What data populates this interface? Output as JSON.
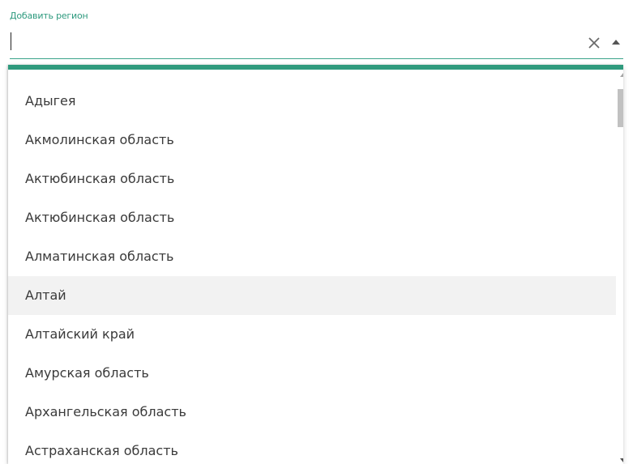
{
  "field": {
    "label": "Добавить регион",
    "value": "",
    "placeholder": ""
  },
  "icons": {
    "clear": "close-icon",
    "toggle": "caret-up-icon"
  },
  "colors": {
    "accent": "#2f9a7d",
    "label": "#2e9a7e",
    "active_row": "#f2f2f2"
  },
  "dropdown": {
    "items": [
      {
        "label": "Адыгея"
      },
      {
        "label": "Акмолинская область"
      },
      {
        "label": "Актюбинская область"
      },
      {
        "label": "Актюбинская область"
      },
      {
        "label": "Алматинская область"
      },
      {
        "label": "Алтай"
      },
      {
        "label": "Алтайский край"
      },
      {
        "label": "Амурская область"
      },
      {
        "label": "Архангельская область"
      },
      {
        "label": "Астраханская область"
      }
    ],
    "highlighted_index": 5
  }
}
